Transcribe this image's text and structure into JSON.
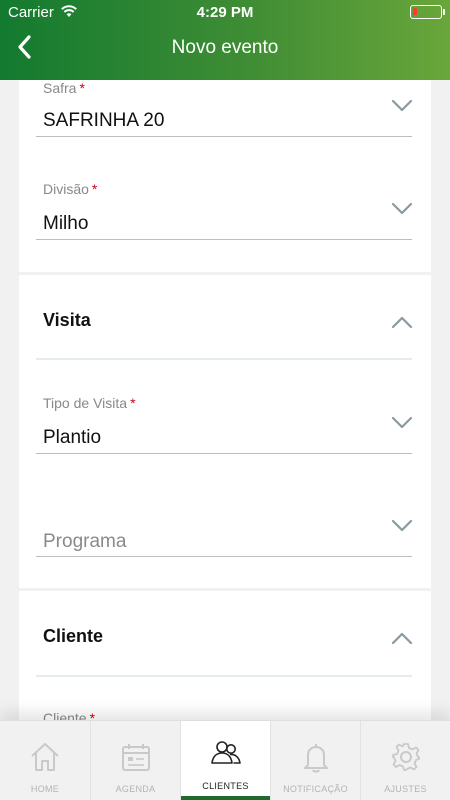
{
  "status_bar": {
    "carrier": "Carrier",
    "time": "4:29 PM"
  },
  "header": {
    "title": "Novo evento"
  },
  "fields": {
    "safra": {
      "label": "Safra",
      "required": "*",
      "value": "SAFRINHA 20"
    },
    "divisao": {
      "label": "Divisão",
      "required": "*",
      "value": "Milho"
    },
    "tipo_visita": {
      "label": "Tipo de Visita",
      "required": "*",
      "value": "Plantio"
    },
    "programa": {
      "placeholder": "Programa"
    },
    "cliente": {
      "label": "Cliente",
      "required": "*"
    }
  },
  "sections": {
    "visita": {
      "title": "Visita"
    },
    "cliente": {
      "title": "Cliente"
    }
  },
  "tabbar": {
    "items": [
      {
        "label": "HOME",
        "icon": "home-icon"
      },
      {
        "label": "AGENDA",
        "icon": "calendar-icon"
      },
      {
        "label": "CLIENTES",
        "icon": "users-icon",
        "active": true
      },
      {
        "label": "NOTIFICAÇÃO",
        "icon": "bell-icon"
      },
      {
        "label": "AJUSTES",
        "icon": "gear-icon"
      }
    ]
  },
  "colors": {
    "header_start": "#137a30",
    "header_end": "#6aa63b",
    "required": "#d0021b",
    "active_tab_bar": "#1e6b2d"
  }
}
